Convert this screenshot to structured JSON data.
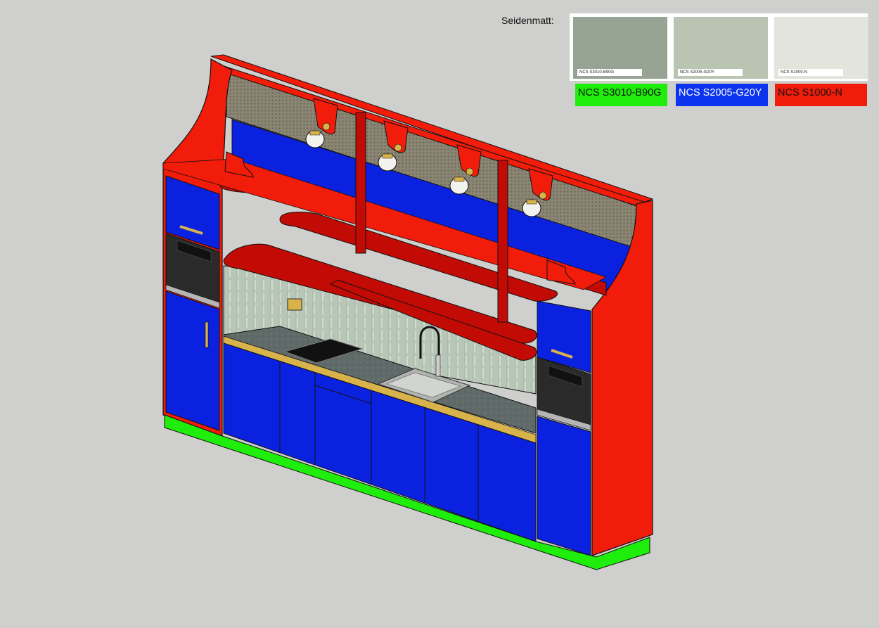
{
  "legend": {
    "finish": "Seidenmatt:",
    "swatches": [
      {
        "code": "NCS S3010-B90G",
        "color": "#97a393",
        "key_color": "#1fee0c",
        "key_text_color": "#111111"
      },
      {
        "code": "NCS S2005-G20Y",
        "color": "#b9c5b2",
        "key_color": "#0c34ee",
        "key_text_color": "#ffffff"
      },
      {
        "code": "NCS S1000-N",
        "color": "#e3e4dc",
        "key_color": "#f21c0a",
        "key_text_color": "#111111"
      }
    ]
  },
  "colors": {
    "frame_red": "#f21c0a",
    "shelf_red": "#c20b05",
    "door_blue": "#0a22e0",
    "plinth_green": "#1fee0c",
    "backsplash": "#b8c6b7",
    "counter": "#5f6a69",
    "wood_edge": "#d8b24a",
    "mesh": "#8b8573"
  }
}
